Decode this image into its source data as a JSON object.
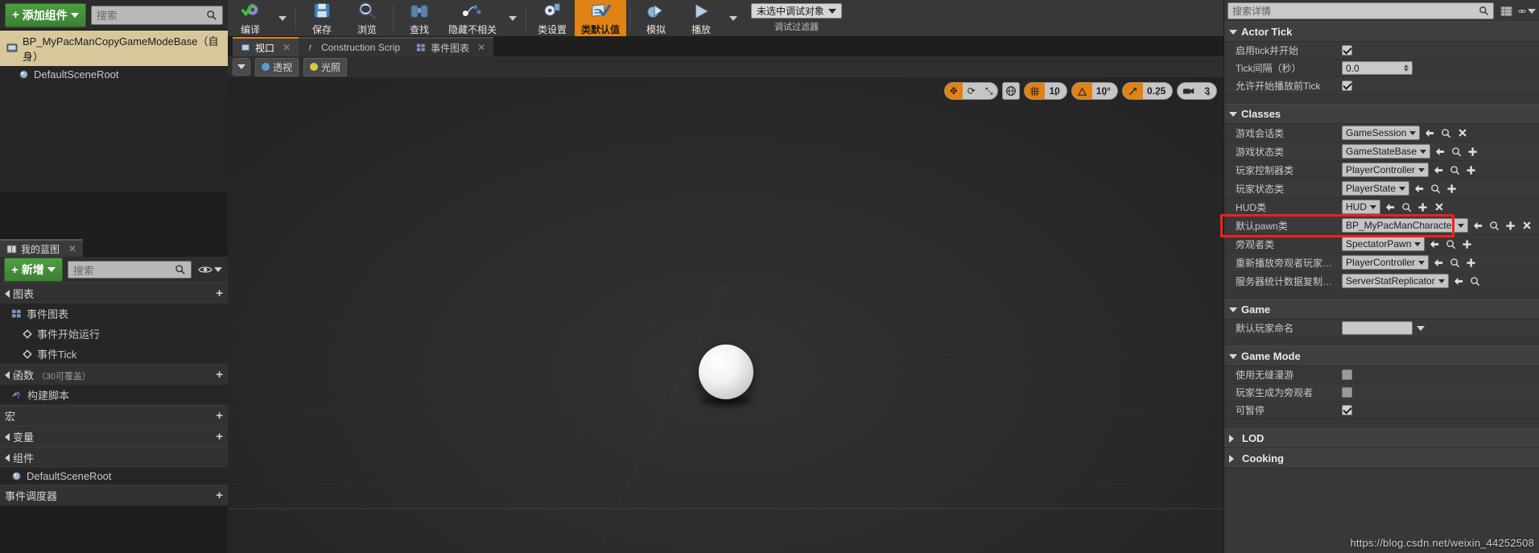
{
  "components_panel": {
    "add_button": "添加组件",
    "search_placeholder": "搜索",
    "root_item": "BP_MyPacManCopyGameModeBase（自身）",
    "child_item": "DefaultSceneRoot"
  },
  "my_blueprint": {
    "tab_label": "我的蓝图",
    "add_button": "新增",
    "search_placeholder": "搜索",
    "sections": [
      {
        "title": "图表",
        "sub": ""
      },
      {
        "title": "函数",
        "sub": "（30可覆盖）"
      },
      {
        "title": "宏",
        "sub": ""
      },
      {
        "title": "变量",
        "sub": ""
      },
      {
        "title": "组件",
        "sub": ""
      },
      {
        "title": "事件调度器",
        "sub": ""
      }
    ],
    "graph_item": "事件图表",
    "graph_children": [
      "事件开始运行",
      "事件Tick"
    ],
    "function_item": "构建脚本",
    "component_item": "DefaultSceneRoot"
  },
  "toolbar": {
    "compile": "编译",
    "save": "保存",
    "browse": "浏览",
    "find": "查找",
    "hide_unrelated": "隐藏不相关",
    "class_settings": "类设置",
    "class_defaults": "类默认值",
    "simulate": "模拟",
    "play": "播放",
    "debug_target": "未选中调试对象",
    "debug_filter_label": "调试过滤器"
  },
  "editor_tabs": [
    {
      "label": "视口",
      "selected": true,
      "closable": true
    },
    {
      "label": "Construction Scrip",
      "selected": false,
      "closable": false
    },
    {
      "label": "事件图表",
      "selected": false,
      "closable": true
    }
  ],
  "viewport": {
    "perspective": "透视",
    "lit": "光照",
    "grid_snap": "10",
    "angle_snap": "10°",
    "scale_snap": "0.25",
    "camera_speed": "3"
  },
  "details": {
    "search_placeholder": "搜索详情",
    "categories": [
      {
        "name": "Actor Tick",
        "open": true,
        "rows": [
          {
            "label": "启用tick并开始",
            "type": "checkbox",
            "value": "checked"
          },
          {
            "label": "Tick间隔（秒）",
            "type": "number",
            "value": "0.0"
          },
          {
            "label": "允许开始播放前Tick",
            "type": "checkbox",
            "value": "checked"
          }
        ]
      },
      {
        "name": "Classes",
        "open": true,
        "rows": [
          {
            "label": "游戏会话类",
            "type": "class",
            "value": "GameSession",
            "buttons": [
              "back",
              "browse",
              "clear"
            ]
          },
          {
            "label": "游戏状态类",
            "type": "class",
            "value": "GameStateBase",
            "buttons": [
              "back",
              "browse",
              "new"
            ]
          },
          {
            "label": "玩家控制器类",
            "type": "class",
            "value": "PlayerController",
            "buttons": [
              "back",
              "browse",
              "new"
            ]
          },
          {
            "label": "玩家状态类",
            "type": "class",
            "value": "PlayerState",
            "buttons": [
              "back",
              "browse",
              "new"
            ]
          },
          {
            "label": "HUD类",
            "type": "class",
            "value": "HUD",
            "buttons": [
              "back",
              "browse",
              "new",
              "clear"
            ]
          },
          {
            "label": "默认pawn类",
            "type": "class",
            "value": "BP_MyPacManCharacter",
            "buttons": [
              "back",
              "browse",
              "new",
              "clear",
              "revert"
            ],
            "highlighted": true
          },
          {
            "label": "旁观者类",
            "type": "class",
            "value": "SpectatorPawn",
            "buttons": [
              "back",
              "browse",
              "new"
            ]
          },
          {
            "label": "重新播放旁观者玩家控制器类",
            "type": "class",
            "value": "PlayerController",
            "buttons": [
              "back",
              "browse",
              "new"
            ]
          },
          {
            "label": "服务器统计数据复制器类",
            "type": "class",
            "value": "ServerStatReplicator",
            "buttons": [
              "back",
              "browse"
            ]
          }
        ]
      },
      {
        "name": "Game",
        "open": true,
        "rows": [
          {
            "label": "默认玩家命名",
            "type": "text",
            "value": ""
          }
        ]
      },
      {
        "name": "Game Mode",
        "open": true,
        "rows": [
          {
            "label": "使用无缝漫游",
            "type": "checkbox",
            "value": "unchecked"
          },
          {
            "label": "玩家生成为旁观者",
            "type": "checkbox",
            "value": "unchecked"
          },
          {
            "label": "可暂停",
            "type": "checkbox",
            "value": "checked"
          }
        ]
      },
      {
        "name": "LOD",
        "open": false,
        "rows": []
      },
      {
        "name": "Cooking",
        "open": false,
        "rows": []
      }
    ]
  },
  "watermark": "https://blog.csdn.net/weixin_44252508",
  "colors": {
    "accent_orange": "#e08214",
    "highlight_red": "#ff1d1d",
    "green_button": "#4e9f42",
    "selected_row": "#d7c79b"
  }
}
